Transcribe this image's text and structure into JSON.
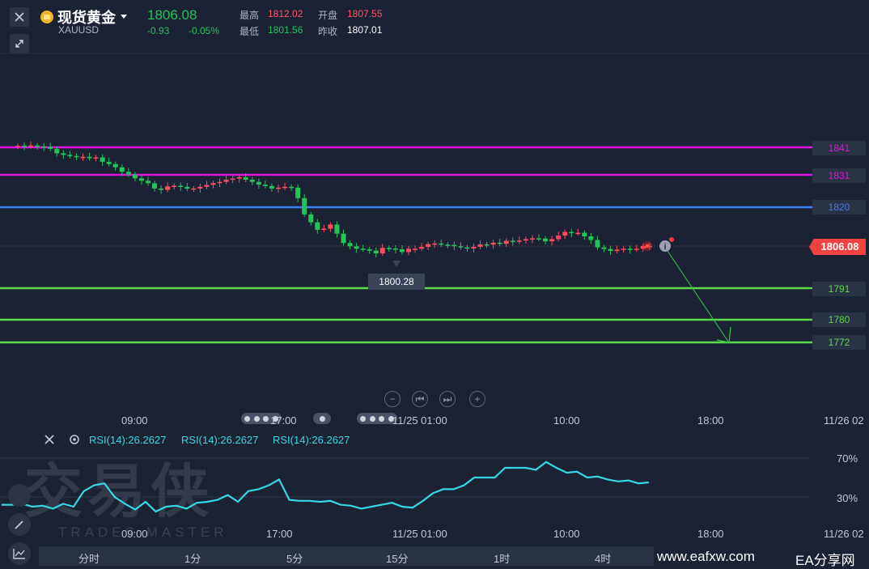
{
  "header": {
    "name": "现货黄金",
    "code": "XAUUSD",
    "price": "1806.08",
    "change": "-0.93",
    "change_pct": "-0.05%",
    "high_label": "最高",
    "high": "1812.02",
    "open_label": "开盘",
    "open": "1807.55",
    "low_label": "最低",
    "low": "1801.56",
    "prev_label": "昨收",
    "prev": "1807.01"
  },
  "price_axis": {
    "levels": [
      {
        "label": "1841",
        "color": "#e010e0"
      },
      {
        "label": "1831",
        "color": "#e010e0"
      },
      {
        "label": "1820",
        "color": "#3f7ef0"
      },
      {
        "label": "1791",
        "color": "#5cd84a"
      },
      {
        "label": "1780",
        "color": "#5cd84a"
      },
      {
        "label": "1772",
        "color": "#5cd84a"
      }
    ],
    "current": "1806.08",
    "low_marker": "1800.28"
  },
  "time_axis": [
    "09:00",
    "17:00",
    "11/25 01:00",
    "10:00",
    "18:00",
    "11/26 02"
  ],
  "rsi": {
    "labels": [
      "RSI(14):26.2627",
      "RSI(14):26.2627",
      "RSI(14):26.2627"
    ],
    "levels": [
      "70%",
      "30%"
    ],
    "values": [
      22,
      22,
      23,
      20,
      21,
      18,
      23,
      20,
      36,
      42,
      44,
      30,
      23,
      17,
      25,
      15,
      20,
      21,
      18,
      24,
      25,
      27,
      32,
      25,
      36,
      38,
      42,
      48,
      27,
      26,
      26,
      25,
      26,
      22,
      21,
      18,
      20,
      22,
      24,
      20,
      19,
      26,
      34,
      38,
      38,
      42,
      50,
      50,
      50,
      60,
      60,
      60,
      58,
      66,
      60,
      55,
      56,
      50,
      51,
      48,
      46,
      47,
      44,
      45
    ],
    "time_axis": [
      "09:00",
      "17:00",
      "11/25 01:00",
      "10:00",
      "18:00",
      "11/26 02"
    ]
  },
  "tabs": [
    "分时",
    "1分",
    "5分",
    "15分",
    "1时",
    "4时"
  ],
  "watermark": {
    "main": "交易侠",
    "sub": "TRADES MASTER"
  },
  "footer": {
    "site": "www.eafxw.com",
    "brand": "EA分享网"
  },
  "candles": {
    "o": [
      1842.5,
      1842.6,
      1842.4,
      1842.6,
      1842.3,
      1842.1,
      1841.4,
      1839.8,
      1839.2,
      1838.8,
      1838.5,
      1838.5,
      1838.0,
      1838.3,
      1836.7,
      1835.9,
      1834.7,
      1833.1,
      1832.1,
      1830.7,
      1829.8,
      1828.9,
      1827.0,
      1826.5,
      1827.8,
      1828.0,
      1827.6,
      1826.9,
      1827.0,
      1827.6,
      1828.3,
      1829.0,
      1829.4,
      1830.2,
      1830.6,
      1831.1,
      1830.2,
      1829.4,
      1828.4,
      1827.9,
      1827.0,
      1827.3,
      1827.6,
      1827.3,
      1823.5,
      1817.6,
      1814.7,
      1812.0,
      1812.4,
      1813.9,
      1810.6,
      1807.2,
      1806.0,
      1805.1,
      1804.9,
      1804.4,
      1803.4,
      1805.4,
      1805.2,
      1804.9,
      1803.9,
      1805.1,
      1805.1,
      1805.8,
      1806.8,
      1807.0,
      1806.6,
      1806.5,
      1806.0,
      1805.6,
      1805.2,
      1805.8,
      1806.7,
      1806.6,
      1807.3,
      1806.9,
      1808.0,
      1807.7,
      1808.1,
      1808.6,
      1808.9,
      1808.8,
      1807.8,
      1808.6,
      1809.9,
      1811.2,
      1810.8,
      1810.9,
      1809.6,
      1808.3,
      1805.6,
      1805.0,
      1804.3,
      1804.8,
      1805.1,
      1804.8,
      1805.1,
      1806.1
    ],
    "c": [
      1842.5,
      1842.4,
      1842.6,
      1842.3,
      1842.1,
      1841.4,
      1839.8,
      1839.2,
      1838.8,
      1838.5,
      1838.5,
      1838.0,
      1838.3,
      1836.7,
      1835.9,
      1834.7,
      1833.1,
      1832.1,
      1830.7,
      1829.8,
      1828.9,
      1827.0,
      1826.5,
      1827.8,
      1828.0,
      1827.6,
      1826.9,
      1827.0,
      1827.6,
      1828.3,
      1829.0,
      1829.4,
      1830.2,
      1830.6,
      1831.1,
      1830.2,
      1829.4,
      1828.4,
      1827.9,
      1827.0,
      1827.3,
      1827.6,
      1827.3,
      1823.5,
      1817.6,
      1814.7,
      1812.0,
      1812.4,
      1813.9,
      1810.6,
      1807.2,
      1806.0,
      1805.1,
      1804.9,
      1804.4,
      1803.4,
      1805.4,
      1805.2,
      1804.9,
      1803.9,
      1805.1,
      1805.1,
      1805.8,
      1806.8,
      1807.0,
      1806.6,
      1806.5,
      1806.0,
      1805.6,
      1805.2,
      1805.8,
      1806.7,
      1806.6,
      1807.3,
      1806.9,
      1808.0,
      1807.7,
      1808.1,
      1808.6,
      1808.9,
      1808.8,
      1807.8,
      1808.6,
      1809.9,
      1811.2,
      1810.8,
      1810.9,
      1809.6,
      1808.3,
      1805.6,
      1805.0,
      1804.3,
      1804.8,
      1805.1,
      1804.8,
      1805.1,
      1806.1,
      1806.1
    ]
  }
}
